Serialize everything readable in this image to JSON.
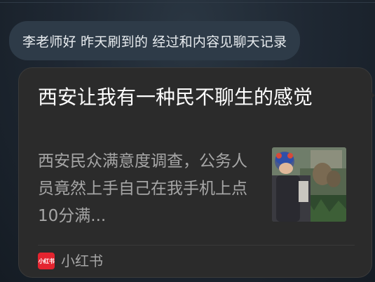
{
  "message": {
    "text": "李老师好 昨天刷到的 经过和内容见聊天记录"
  },
  "shared_card": {
    "title": "西安让我有一种民不聊生的感觉",
    "description": "西安民众满意度调查，公务人员竟然上手自己在我手机上点10分满...",
    "thumbnail_icon": "photo-thumbnail",
    "source": {
      "logo_text": "小红书",
      "name": "小红书",
      "brand_color": "#e4242f"
    }
  },
  "colors": {
    "background": "#1f2833",
    "bubble": "#2e3b48",
    "card": "#2b2b2b"
  }
}
